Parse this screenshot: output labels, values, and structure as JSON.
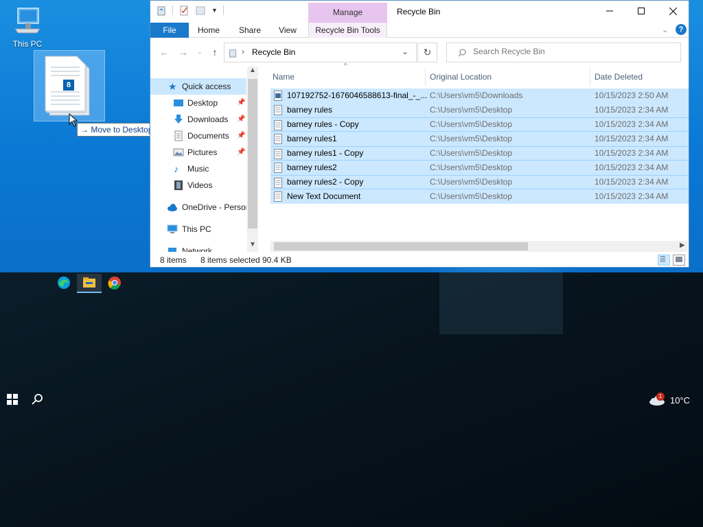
{
  "desktop": {
    "icons": [
      {
        "label": "This PC",
        "icon": "this-pc-icon"
      }
    ],
    "drag": {
      "count_badge": "8",
      "tooltip": "Move to Desktop"
    }
  },
  "window": {
    "title": "Recycle Bin",
    "context_tab": "Manage",
    "ribbon_tabs": {
      "file": "File",
      "home": "Home",
      "share": "Share",
      "view": "View",
      "tools": "Recycle Bin Tools"
    },
    "address": {
      "location": "Recycle Bin"
    },
    "search": {
      "placeholder": "Search Recycle Bin"
    }
  },
  "nav": {
    "quick_access": "Quick access",
    "items": [
      {
        "label": "Desktop",
        "pinned": true
      },
      {
        "label": "Downloads",
        "pinned": true
      },
      {
        "label": "Documents",
        "pinned": true
      },
      {
        "label": "Pictures",
        "pinned": true
      },
      {
        "label": "Music",
        "pinned": false
      },
      {
        "label": "Videos",
        "pinned": false
      }
    ],
    "onedrive": "OneDrive - Persor",
    "this_pc": "This PC",
    "network": "Network"
  },
  "list": {
    "columns": {
      "name": "Name",
      "location": "Original Location",
      "date": "Date Deleted"
    },
    "rows": [
      {
        "name": "107192752-1676046588613-final_-_...",
        "location": "C:\\Users\\vm5\\Downloads",
        "date": "10/15/2023 2:50 AM",
        "type": "image"
      },
      {
        "name": "barney rules",
        "location": "C:\\Users\\vm5\\Desktop",
        "date": "10/15/2023 2:34 AM",
        "type": "text"
      },
      {
        "name": "barney rules - Copy",
        "location": "C:\\Users\\vm5\\Desktop",
        "date": "10/15/2023 2:34 AM",
        "type": "text"
      },
      {
        "name": "barney rules1",
        "location": "C:\\Users\\vm5\\Desktop",
        "date": "10/15/2023 2:34 AM",
        "type": "text"
      },
      {
        "name": "barney rules1 - Copy",
        "location": "C:\\Users\\vm5\\Desktop",
        "date": "10/15/2023 2:34 AM",
        "type": "text"
      },
      {
        "name": "barney rules2",
        "location": "C:\\Users\\vm5\\Desktop",
        "date": "10/15/2023 2:34 AM",
        "type": "text"
      },
      {
        "name": "barney rules2 - Copy",
        "location": "C:\\Users\\vm5\\Desktop",
        "date": "10/15/2023 2:34 AM",
        "type": "text"
      },
      {
        "name": "New Text Document",
        "location": "C:\\Users\\vm5\\Desktop",
        "date": "10/15/2023 2:34 AM",
        "type": "text"
      }
    ]
  },
  "status": {
    "count": "8 items",
    "selected": "8 items selected",
    "size": "90.4 KB"
  },
  "taskbar": {
    "apps": [
      "edge-icon",
      "file-explorer-icon",
      "chrome-icon"
    ],
    "weather": {
      "temp": "10°C",
      "badge": "1"
    }
  },
  "colors": {
    "accent": "#1979ca",
    "selection": "#cce8ff",
    "manage_tab": "#e8c5ef",
    "desktop": "#0a78d4"
  }
}
